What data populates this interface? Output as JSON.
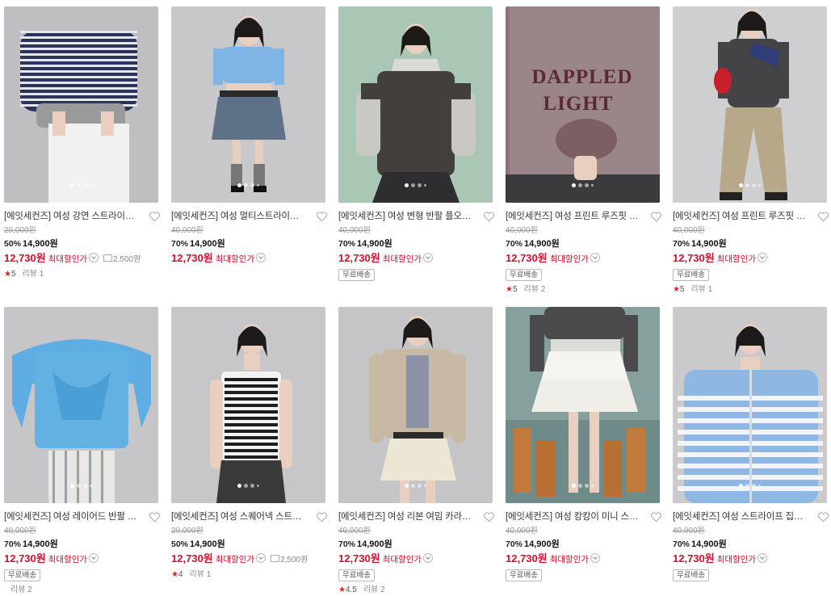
{
  "colors": {
    "sale_red": "#d4112e",
    "star_red": "#e02424",
    "text": "#222222",
    "muted": "#999999"
  },
  "icons": {
    "wishlist": "heart-outline-icon",
    "star": "star-icon",
    "coupon": "coupon-icon",
    "dropdown": "chevron-down-circle-icon"
  },
  "products": [
    {
      "title": "[에잇세컨즈] 여성 강연 스트라이프 피케 반팔 티셔츠",
      "orig": "20,000원",
      "pct": "50%",
      "price": "14,900원",
      "dprice": "12,730원",
      "dlabel": "최대할인가",
      "coupon": "2,500원",
      "badge": "",
      "stars": "5",
      "review": "리뷰 1",
      "dots": 4,
      "bg": "#bfbfc2",
      "fig": "stripe-navy"
    },
    {
      "title": "[에잇세컨즈] 여성 멀티스트라이프 크롭 니트",
      "orig": "40,000원",
      "pct": "70%",
      "price": "14,900원",
      "dprice": "12,730원",
      "dlabel": "최대할인가",
      "coupon": "",
      "badge": "",
      "stars": "",
      "review": "",
      "dots": 4,
      "bg": "#c8c8ca",
      "fig": "blue-knit"
    },
    {
      "title": "[에잇세컨즈] 여성 변형 반팔 플오버 니트",
      "orig": "40,000원",
      "pct": "70%",
      "price": "14,900원",
      "dprice": "12,730원",
      "dlabel": "최대할인가",
      "coupon": "",
      "badge": "무료배송",
      "stars": "",
      "review": "",
      "dots": 4,
      "bg": "#a9c7b4",
      "fig": "charcoal-layer"
    },
    {
      "title": "[에잇세컨즈] 여성 프린트 루즈핏 맨투맨",
      "orig": "40,000원",
      "pct": "70%",
      "price": "14,900원",
      "dprice": "12,730원",
      "dlabel": "최대할인가",
      "coupon": "",
      "badge": "무료배송",
      "stars": "5",
      "review": "리뷰 2",
      "dots": 4,
      "bg": "#8d7579",
      "fig": "print-sweat",
      "print": "DAPPLED LIGHT"
    },
    {
      "title": "[에잇세컨즈] 여성 프린트 루즈핏 티셔츠",
      "orig": "40,000원",
      "pct": "70%",
      "price": "14,900원",
      "dprice": "12,730원",
      "dlabel": "최대할인가",
      "coupon": "",
      "badge": "무료배송",
      "stars": "5",
      "review": "리뷰 1",
      "dots": 4,
      "bg": "#cfcfd1",
      "fig": "grey-long"
    },
    {
      "title": "[에잇세컨즈] 여성 레이어드 반팔 니트",
      "orig": "40,000원",
      "pct": "70%",
      "price": "14,900원",
      "dprice": "12,730원",
      "dlabel": "최대할인가",
      "coupon": "",
      "badge": "무료배송",
      "stars": "",
      "review": "리뷰 2",
      "dots": 4,
      "bg": "#c6c6c8",
      "fig": "sky-layer"
    },
    {
      "title": "[에잇세컨즈] 여성 스퀘어넥 스트라이프 슬리브리스",
      "orig": "20,000원",
      "pct": "50%",
      "price": "14,900원",
      "dprice": "12,730원",
      "dlabel": "최대할인가",
      "coupon": "2,500원",
      "badge": "",
      "stars": "4",
      "review": "리뷰 1",
      "dots": 4,
      "bg": "#c7c7c9",
      "fig": "stripe-tank"
    },
    {
      "title": "[에잇세컨즈] 여성 리본 여밈 카라 셔츠",
      "orig": "40,000원",
      "pct": "70%",
      "price": "14,900원",
      "dprice": "12,730원",
      "dlabel": "최대할인가",
      "coupon": "",
      "badge": "무료배송",
      "stars": "4.5",
      "review": "리뷰 2",
      "dots": 4,
      "bg": "#c5c5c7",
      "fig": "beige-shirt"
    },
    {
      "title": "[에잇세컨즈] 여성 캉캉이 미니 스커트",
      "orig": "40,000원",
      "pct": "70%",
      "price": "14,900원",
      "dprice": "12,730원",
      "dlabel": "최대할인가",
      "coupon": "",
      "badge": "무료배송",
      "stars": "",
      "review": "",
      "dots": 4,
      "bg": "#7e9896",
      "fig": "white-skirt"
    },
    {
      "title": "[에잇세컨즈] 여성 스트라이프 집업 가디건",
      "orig": "40,000원",
      "pct": "70%",
      "price": "14,900원",
      "dprice": "12,730원",
      "dlabel": "최대할인가",
      "coupon": "",
      "badge": "무료배송",
      "stars": "",
      "review": "",
      "dots": 4,
      "bg": "#cacacc",
      "fig": "blue-stripe-zip"
    }
  ]
}
